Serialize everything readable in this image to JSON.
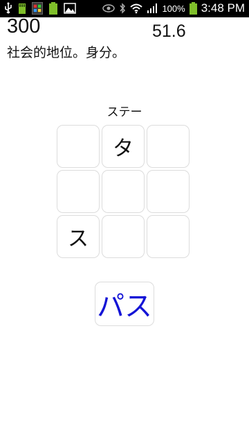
{
  "status_bar": {
    "battery_percent": "100%",
    "time": "3:48 PM",
    "left_icons": [
      "usb-icon",
      "sdcard-icon",
      "app-icon",
      "battery-small-icon",
      "image-icon"
    ],
    "right_icons": [
      "eye-icon",
      "bluetooth-icon",
      "wifi-icon",
      "signal-icon",
      "battery-icon"
    ]
  },
  "header": {
    "score": "300",
    "timer": "51.6",
    "meaning": "社会的地位。身分。"
  },
  "game": {
    "partial_word": "ステー",
    "grid": [
      [
        "",
        "タ",
        ""
      ],
      [
        "",
        "",
        ""
      ],
      [
        "ス",
        "",
        ""
      ]
    ]
  },
  "pass_button": {
    "label": "パス",
    "color": "#1414d6"
  }
}
